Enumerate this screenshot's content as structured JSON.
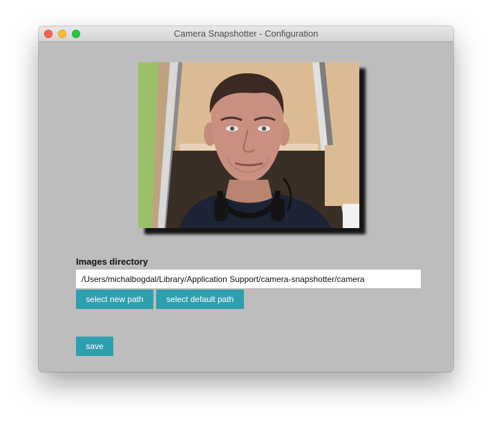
{
  "window": {
    "title": "Camera Snapshotter - Configuration"
  },
  "colors": {
    "window_background": "#bdbdbd",
    "button_background": "#2e9fae",
    "button_text": "#ffffff"
  },
  "preview": {
    "description_icon": "camera-preview-image"
  },
  "form": {
    "directory_label": "Images directory",
    "directory_path": "/Users/michalbogdal/Library/Application Support/camera-snapshotter/camera",
    "select_new_path_label": "select new path",
    "select_default_path_label": "select default path",
    "save_label": "save"
  }
}
